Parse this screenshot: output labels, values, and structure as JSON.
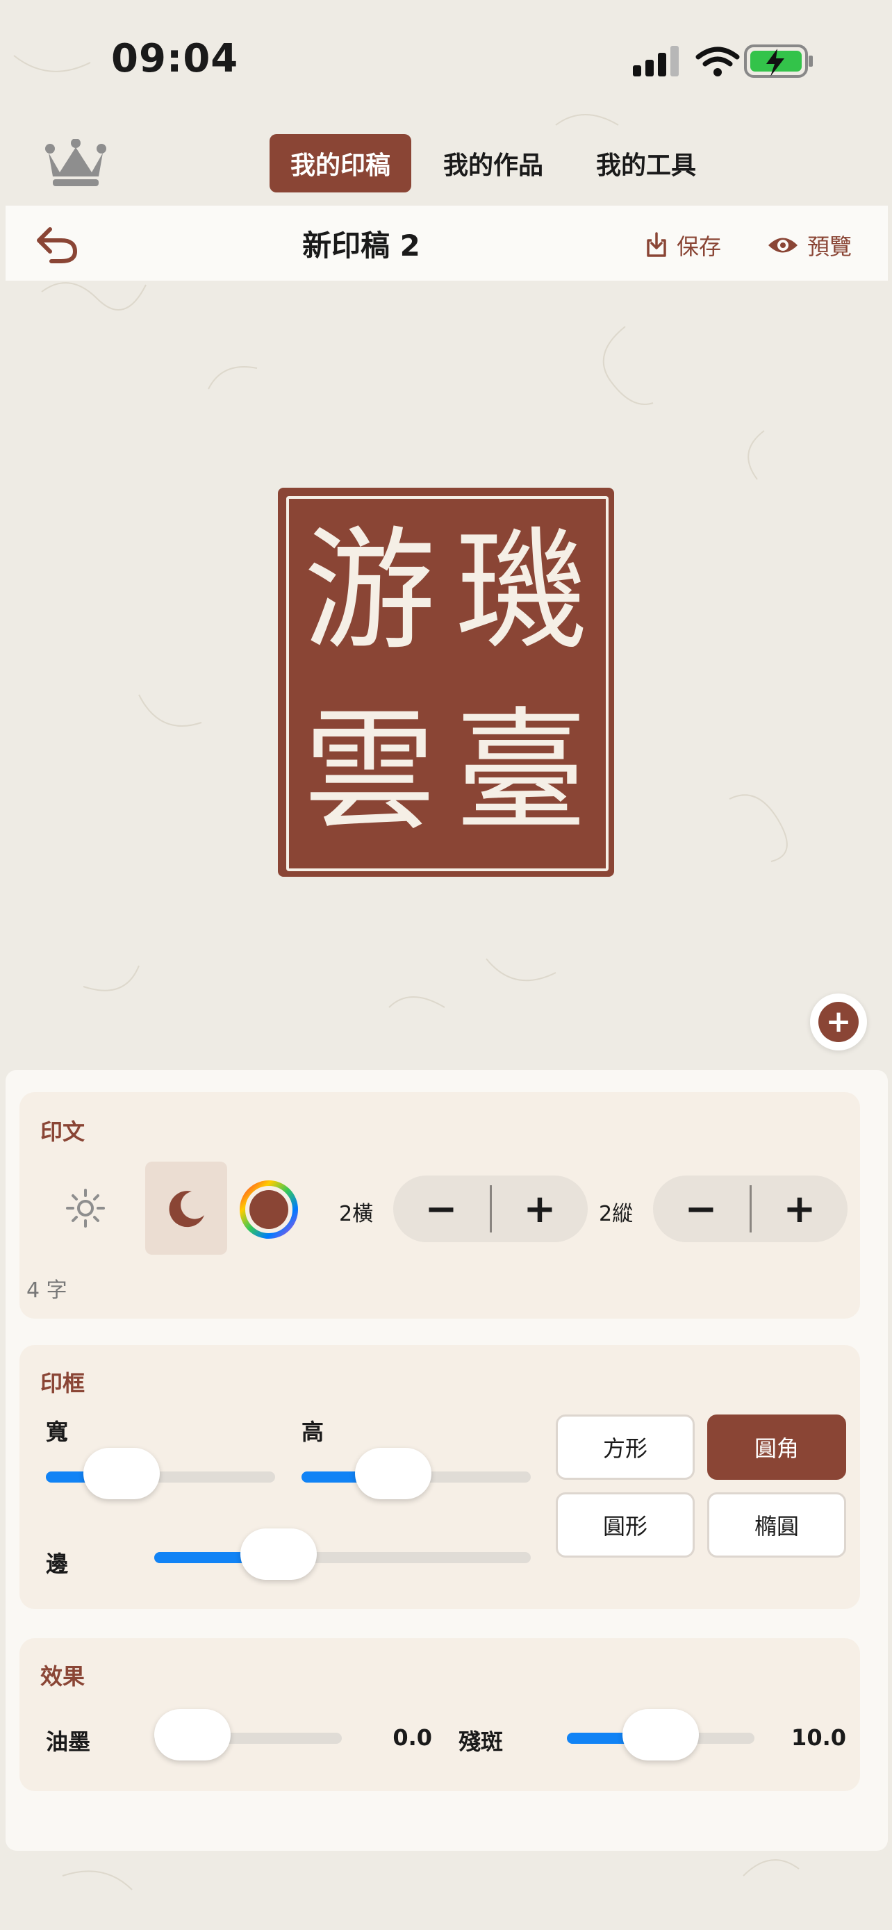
{
  "status_bar": {
    "time": "09:04"
  },
  "nav": {
    "tabs": [
      {
        "label": "我的印稿",
        "active": true
      },
      {
        "label": "我的作品",
        "active": false
      },
      {
        "label": "我的工具",
        "active": false
      }
    ]
  },
  "doc": {
    "title": "新印稿 2",
    "save_label": "保存",
    "preview_label": "預覽"
  },
  "seal": {
    "characters": [
      "璣",
      "臺",
      "游",
      "雲"
    ],
    "color": "#8a4535"
  },
  "inscription": {
    "title": "印文",
    "columns_label": "2橫",
    "rows_label": "2縱",
    "char_count": "4 字"
  },
  "frame": {
    "title": "印框",
    "width_label": "寬",
    "height_label": "高",
    "border_label": "邊",
    "width_value": 0.33,
    "height_value": 0.4,
    "border_value": 0.33,
    "shapes": [
      {
        "label": "方形",
        "active": false
      },
      {
        "label": "圓角",
        "active": true
      },
      {
        "label": "圓形",
        "active": false
      },
      {
        "label": "橢圓",
        "active": false
      }
    ]
  },
  "effects": {
    "title": "效果",
    "ink_label": "油墨",
    "ink_value": "0.0",
    "wear_label": "殘斑",
    "wear_value": "10.0"
  },
  "accent": "#8a4535",
  "slider_color": "#1183f5"
}
